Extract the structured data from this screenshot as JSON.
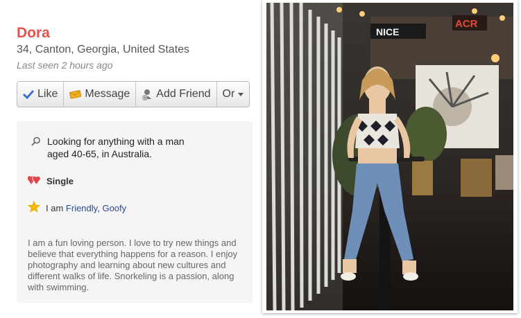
{
  "profile": {
    "name": "Dora",
    "location": "34, Canton, Georgia, United States",
    "last_seen": "Last seen 2 hours ago"
  },
  "actions": {
    "like": "Like",
    "message": "Message",
    "add_friend": "Add Friend",
    "more": "Or"
  },
  "details": {
    "looking_line1": "Looking for anything with a man",
    "looking_line2": "aged 40-65, in Australia.",
    "status": "Single",
    "traits_prefix": "I am",
    "traits": [
      "Friendly",
      "Goofy"
    ],
    "traits_sep": ",",
    "about": "I am a fun loving person. I love to try new things and believe that everything happens for a reason. I enjoy photography and learning about new cultures and different walks of life. Snorkeling is a passion, along with swimming."
  },
  "colors": {
    "name": "#e8524a",
    "link": "#2a4a8a",
    "like_check": "#3b6fd4",
    "message_icon": "#f0b020",
    "heart": "#e0474c",
    "star": "#f5b800"
  },
  "icons": {
    "like": "check-icon",
    "message": "envelope-icon",
    "add_friend": "person-add-icon",
    "more": "caret-down-icon",
    "looking": "search-icon",
    "status": "hearts-icon",
    "traits": "star-icon"
  },
  "photo_sign_text": "ACR"
}
